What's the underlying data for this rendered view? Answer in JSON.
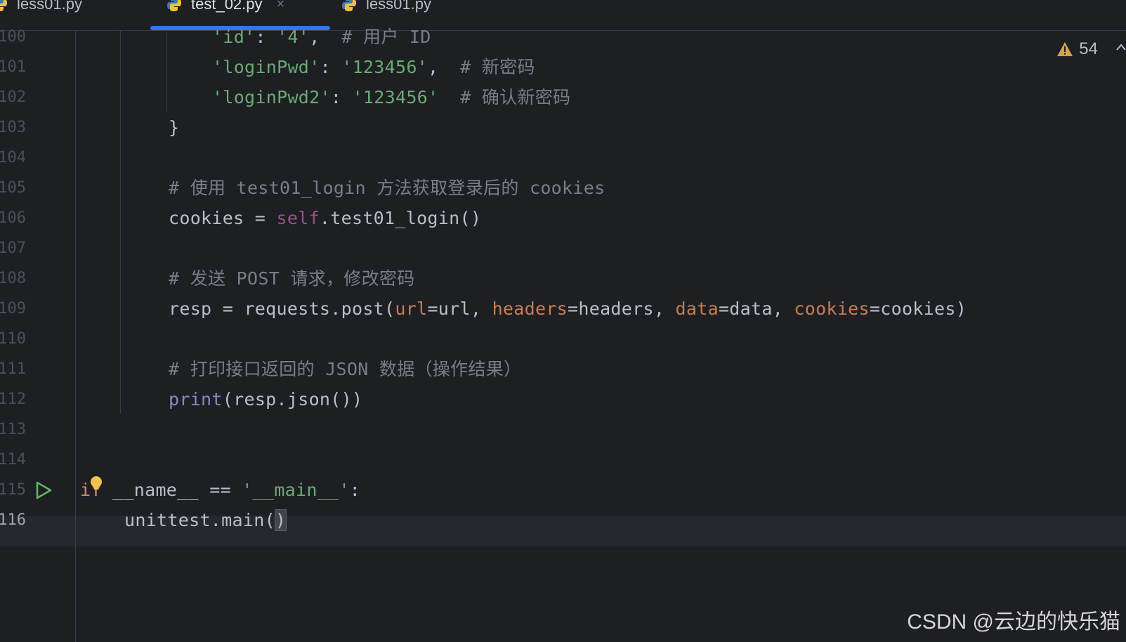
{
  "tabs": [
    {
      "label": "less01.py",
      "active": false
    },
    {
      "label": "test_02.py",
      "active": true
    },
    {
      "label": "less01.py",
      "active": false
    }
  ],
  "tab_close": "×",
  "inspection": {
    "warning_count": "54"
  },
  "lines": [
    {
      "no": "100",
      "code": "'id': '4',  # 用户 ID"
    },
    {
      "no": "101",
      "code": "'loginPwd': '123456',  # 新密码"
    },
    {
      "no": "102",
      "code": "'loginPwd2': '123456'  # 确认新密码"
    },
    {
      "no": "103",
      "code": "}"
    },
    {
      "no": "104",
      "code": ""
    },
    {
      "no": "105",
      "code": "# 使用 test01_login 方法获取登录后的 cookies"
    },
    {
      "no": "106",
      "code": "cookies = self.test01_login()"
    },
    {
      "no": "107",
      "code": ""
    },
    {
      "no": "108",
      "code": "# 发送 POST 请求，修改密码"
    },
    {
      "no": "109",
      "code": "resp = requests.post(url=url, headers=headers, data=data, cookies=cookies)"
    },
    {
      "no": "110",
      "code": ""
    },
    {
      "no": "111",
      "code": "# 打印接口返回的 JSON 数据（操作结果）"
    },
    {
      "no": "112",
      "code": "print(resp.json())"
    },
    {
      "no": "113",
      "code": ""
    },
    {
      "no": "114",
      "code": ""
    },
    {
      "no": "115",
      "code": "if __name__ == '__main__':"
    },
    {
      "no": "116",
      "code": "unittest.main()"
    }
  ],
  "watermark": "CSDN @云边的快乐猫",
  "colors": {
    "background": "#1e1f22",
    "accent": "#3574f0",
    "string": "#6aab73",
    "comment": "#7a7e85",
    "keyword": "#cf8e6d",
    "self": "#94558d",
    "named_arg": "#c77d55",
    "builtin": "#8888c6"
  },
  "icons": [
    "python-file-icon",
    "close-icon",
    "warning-icon",
    "run-icon",
    "lightbulb-icon",
    "chevron-up-icon"
  ]
}
